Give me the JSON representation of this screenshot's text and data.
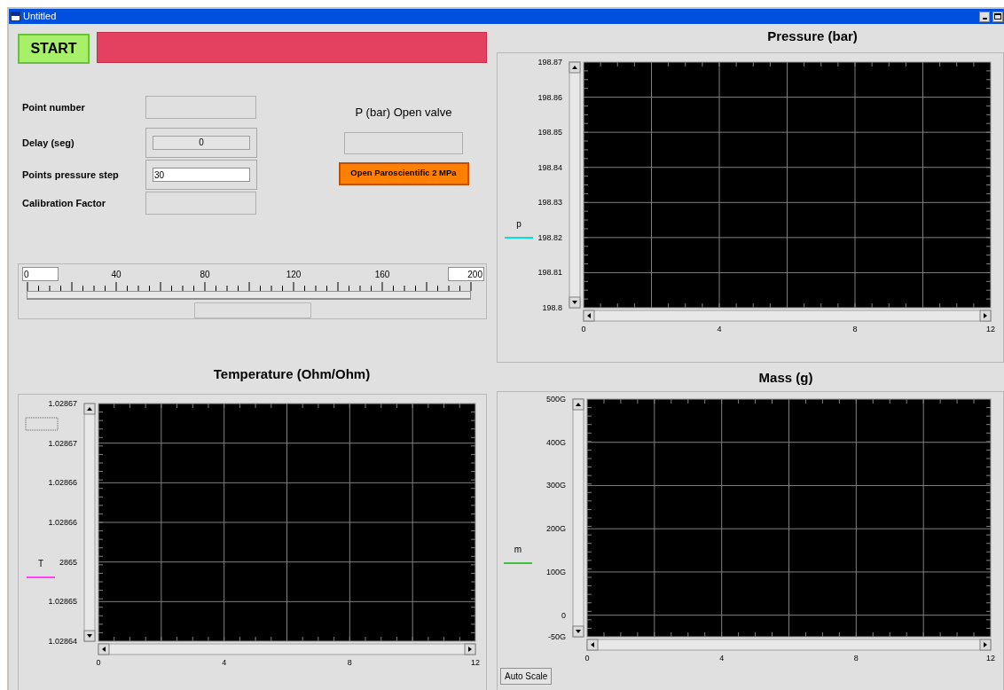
{
  "window": {
    "title": "Untitled"
  },
  "start_button": {
    "label": "START"
  },
  "fields": [
    {
      "label": "Point number",
      "kind": "indicator"
    },
    {
      "label": "Delay (seg)",
      "kind": "numeric",
      "value": "0"
    },
    {
      "label": "Points pressure step",
      "kind": "control",
      "value": "30"
    },
    {
      "label": "Calibration Factor",
      "kind": "indicator"
    }
  ],
  "valve": {
    "heading": "P (bar) Open valve",
    "button": "Open Paroscientific 2 MPa"
  },
  "slider": {
    "min": "0",
    "max": "200",
    "scale_labels": [
      "40",
      "80",
      "120",
      "160"
    ]
  },
  "charts": [
    {
      "title": "Pressure (bar)",
      "y_axis_labels": [
        "198.87",
        "198.86",
        "198.85",
        "198.84",
        "198.83",
        "198.82",
        "198.81",
        "198.8"
      ],
      "x_axis_labels": [
        "0",
        "4",
        "8",
        "12"
      ],
      "legend": {
        "name": "p",
        "color": "#00e0e0"
      }
    },
    {
      "title": "Temperature (Ohm/Ohm)",
      "y_axis_labels": [
        "1.02867",
        "1.02867",
        "1.02866",
        "1.02866",
        "2865",
        "1.02865",
        "1.02864"
      ],
      "x_axis_labels": [
        "0",
        "4",
        "8",
        "12"
      ],
      "legend": {
        "name": "T",
        "color": "#ff40ff"
      }
    },
    {
      "title": "Mass (g)",
      "y_axis_labels": [
        "500G",
        "400G",
        "300G",
        "200G",
        "100G",
        "0",
        "-50G"
      ],
      "x_axis_labels": [
        "0",
        "4",
        "8",
        "12"
      ],
      "legend": {
        "name": "m",
        "color": "#40c040"
      },
      "auto_scale_button": "Auto Scale"
    }
  ]
}
